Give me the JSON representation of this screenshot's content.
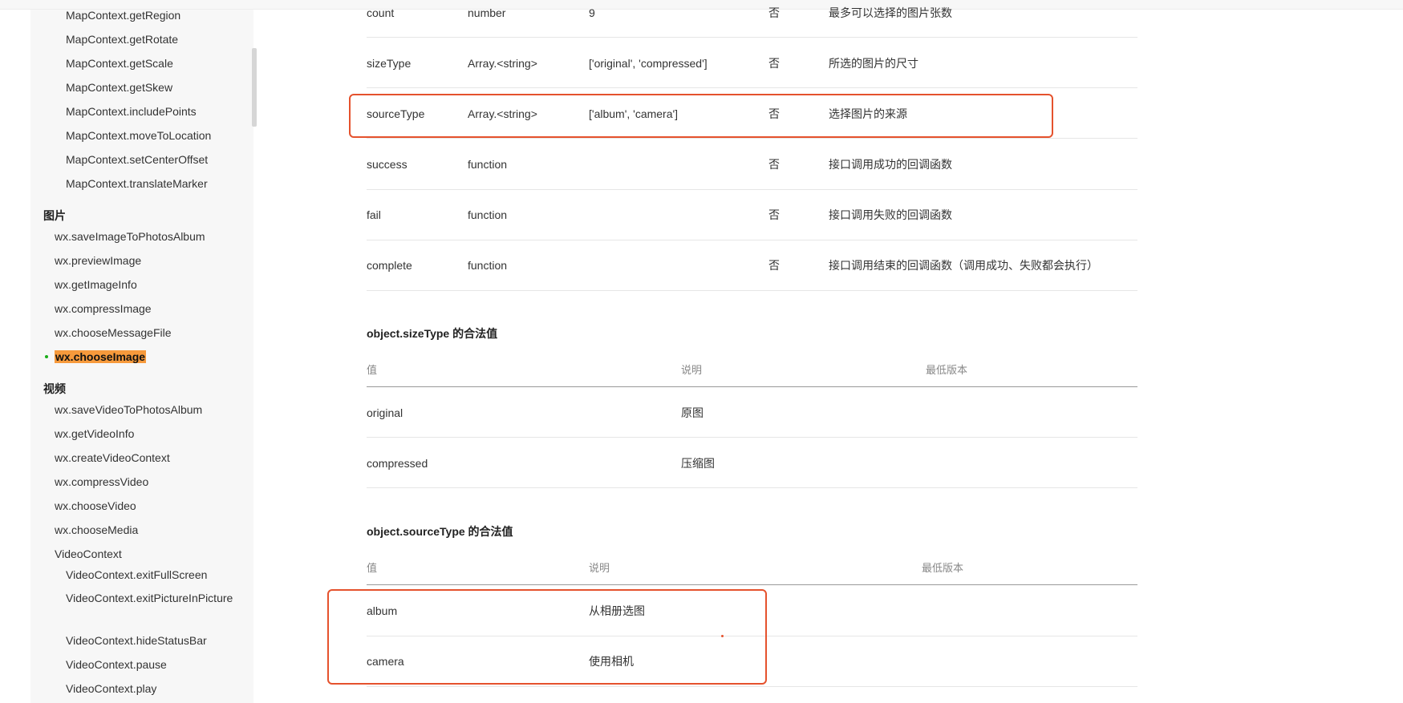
{
  "sidebar": {
    "items_top": [
      "MapContext.getRegion",
      "MapContext.getRotate",
      "MapContext.getScale",
      "MapContext.getSkew",
      "MapContext.includePoints",
      "MapContext.moveToLocation",
      "MapContext.setCenterOffset",
      "MapContext.translateMarker"
    ],
    "group_image": "图片",
    "image_items": [
      "wx.saveImageToPhotosAlbum",
      "wx.previewImage",
      "wx.getImageInfo",
      "wx.compressImage",
      "wx.chooseMessageFile",
      "wx.chooseImage"
    ],
    "group_video": "视频",
    "video_items": [
      "wx.saveVideoToPhotosAlbum",
      "wx.getVideoInfo",
      "wx.createVideoContext",
      "wx.compressVideo",
      "wx.chooseVideo",
      "wx.chooseMedia",
      "VideoContext"
    ],
    "videocontext_items": [
      "VideoContext.exitFullScreen",
      "VideoContext.exitPictureInPicture",
      "VideoContext.hideStatusBar",
      "VideoContext.pause",
      "VideoContext.play"
    ]
  },
  "params_table": {
    "rows": [
      [
        "count",
        "number",
        "9",
        "否",
        "最多可以选择的图片张数"
      ],
      [
        "sizeType",
        "Array.<string>",
        "['original', 'compressed']",
        "否",
        "所选的图片的尺寸"
      ],
      [
        "sourceType",
        "Array.<string>",
        "['album', 'camera']",
        "否",
        "选择图片的来源"
      ],
      [
        "success",
        "function",
        "",
        "否",
        "接口调用成功的回调函数"
      ],
      [
        "fail",
        "function",
        "",
        "否",
        "接口调用失败的回调函数"
      ],
      [
        "complete",
        "function",
        "",
        "否",
        "接口调用结束的回调函数（调用成功、失败都会执行）"
      ]
    ]
  },
  "sizetype_section": {
    "title": "object.sizeType 的合法值",
    "headers": [
      "值",
      "说明",
      "最低版本"
    ],
    "rows": [
      [
        "original",
        "原图",
        ""
      ],
      [
        "compressed",
        "压缩图",
        ""
      ]
    ]
  },
  "sourcetype_section": {
    "title": "object.sourceType 的合法值",
    "headers": [
      "值",
      "说明",
      "最低版本"
    ],
    "rows": [
      [
        "album",
        "从相册选图",
        ""
      ],
      [
        "camera",
        "使用相机",
        ""
      ]
    ]
  },
  "colors": {
    "annotation": "#e5522d",
    "active_highlight": "#f79a3c",
    "active_dot": "#1aad19"
  }
}
